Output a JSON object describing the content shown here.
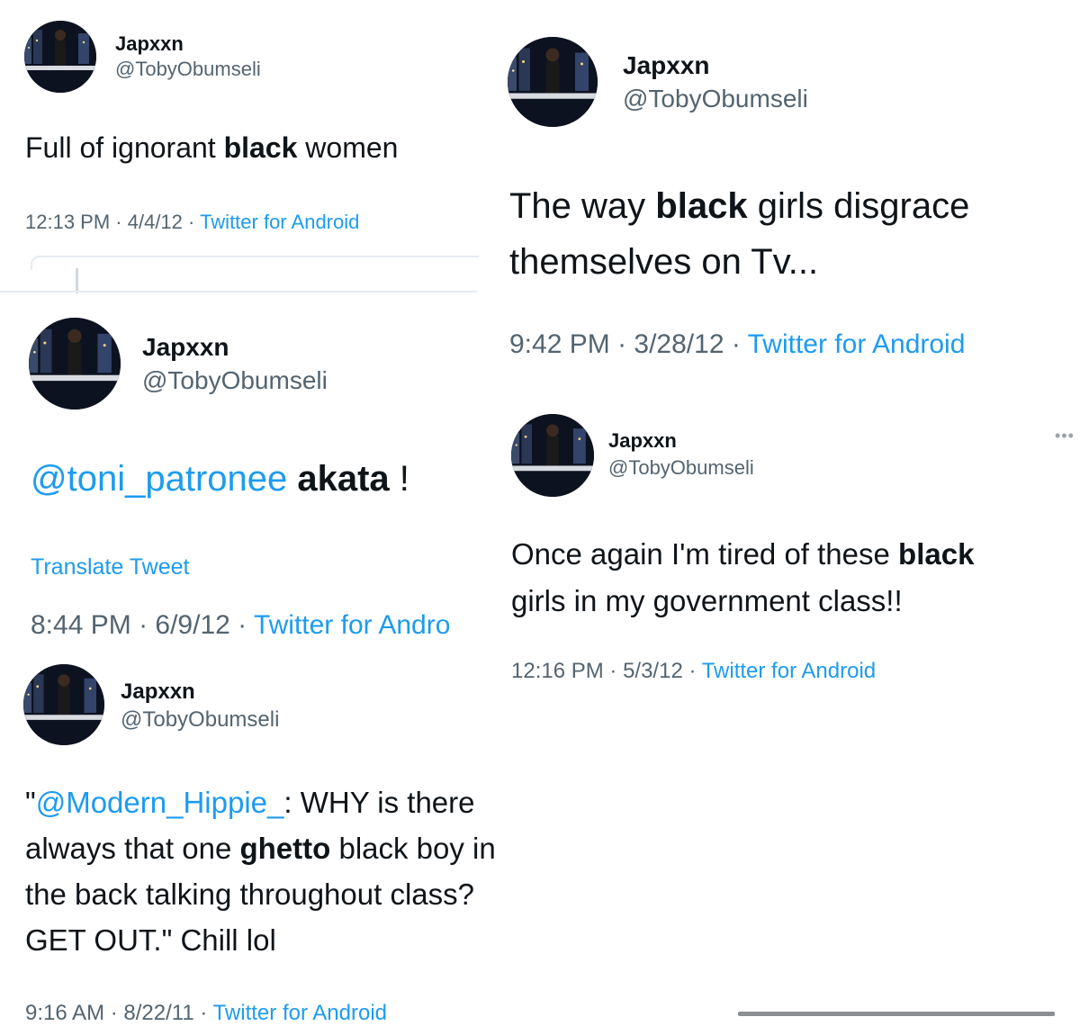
{
  "tweets": [
    {
      "name": "Japxxn",
      "handle": "@TobyObumseli",
      "text": [
        {
          "t": "Full of ignorant "
        },
        {
          "t": "black",
          "b": true
        },
        {
          "t": " women"
        }
      ],
      "time": "12:13 PM",
      "date": "4/4/12",
      "source": "Twitter for Android"
    },
    {
      "name": "Japxxn",
      "handle": "@TobyObumseli",
      "line1": [
        {
          "t": "The way "
        },
        {
          "t": "black",
          "b": true
        },
        {
          "t": " girls disgrace"
        }
      ],
      "line2": "themselves on Tv...",
      "time": "9:42 PM",
      "date": "3/28/12",
      "source": "Twitter for Android"
    },
    {
      "name": "Japxxn",
      "handle": "@TobyObumseli",
      "text": [
        {
          "t": "@toni_patronee "
        },
        {
          "t": "akata",
          "b": true
        },
        {
          "t": " !"
        }
      ],
      "translate": "Translate Tweet",
      "time": "8:44 PM",
      "date": "6/9/12",
      "source": "Twitter for Andro"
    },
    {
      "name": "Japxxn",
      "handle": "@TobyObumseli",
      "line1": [
        {
          "t": "Once again I'm tired of these "
        },
        {
          "t": "black",
          "b": true
        }
      ],
      "line2": "girls in my government class!!",
      "time": "12:16 PM",
      "date": "5/3/12",
      "source": "Twitter for Android"
    },
    {
      "name": "Japxxn",
      "handle": "@TobyObumseli",
      "line1_quote": "\"",
      "line1_mention": "@Modern_Hippie_",
      "line1_rest": ": WHY is there",
      "line2": [
        {
          "t": "always that one "
        },
        {
          "t": "ghetto",
          "b": true
        },
        {
          "t": " black boy in"
        }
      ],
      "line3": "the back talking throughout class?",
      "line4": "GET OUT.\" Chill lol",
      "time": "9:16 AM",
      "date": "8/22/11",
      "source": "Twitter for Android"
    }
  ],
  "separator": " · ",
  "more_icon": "more-dots-icon",
  "colors": {
    "link": "#1d9bf0",
    "secondary": "#536471",
    "text": "#0f1419"
  }
}
